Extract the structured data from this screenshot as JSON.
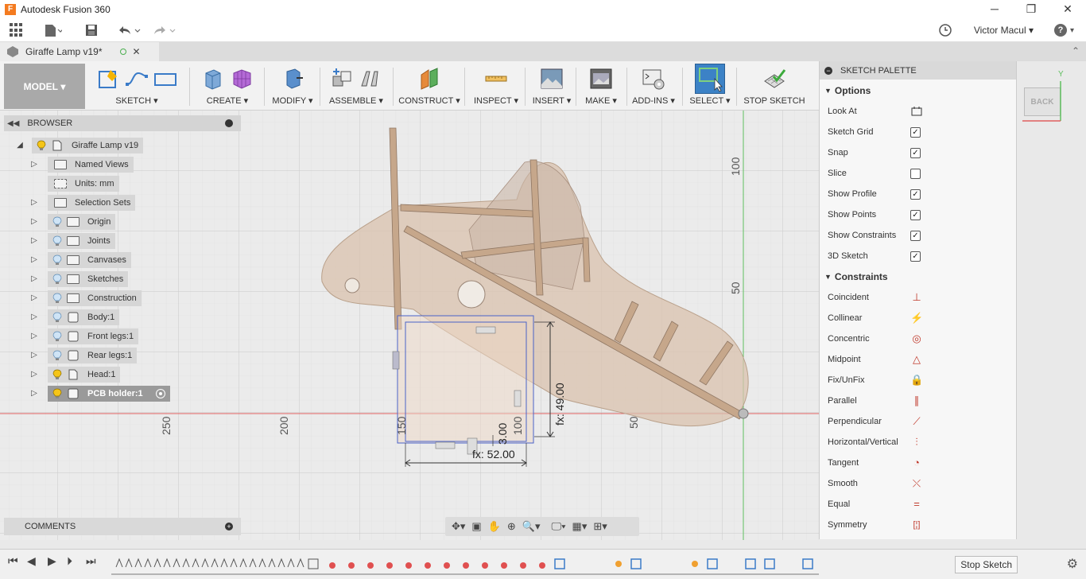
{
  "window": {
    "title": "Autodesk Fusion 360",
    "controls": {
      "minimize": "─",
      "maximize": "❐",
      "close": "✕"
    }
  },
  "qat": {
    "user": "Victor Macul",
    "help": "?"
  },
  "doc_tab": {
    "title": "Giraffe Lamp v19*"
  },
  "toolbar": {
    "workspace": "MODEL",
    "groups": [
      {
        "label": "SKETCH ▾"
      },
      {
        "label": "CREATE ▾"
      },
      {
        "label": "MODIFY ▾"
      },
      {
        "label": "ASSEMBLE ▾"
      },
      {
        "label": "CONSTRUCT ▾"
      },
      {
        "label": "INSPECT ▾"
      },
      {
        "label": "INSERT ▾"
      },
      {
        "label": "MAKE ▾"
      },
      {
        "label": "ADD-INS ▾"
      },
      {
        "label": "SELECT ▾"
      },
      {
        "label": "STOP SKETCH"
      }
    ]
  },
  "browser": {
    "title": "BROWSER",
    "items": [
      {
        "label": "Giraffe Lamp v19"
      },
      {
        "label": "Named Views"
      },
      {
        "label": "Units: mm"
      },
      {
        "label": "Selection Sets"
      },
      {
        "label": "Origin"
      },
      {
        "label": "Joints"
      },
      {
        "label": "Canvases"
      },
      {
        "label": "Sketches"
      },
      {
        "label": "Construction"
      },
      {
        "label": "Body:1"
      },
      {
        "label": "Front legs:1"
      },
      {
        "label": "Rear legs:1"
      },
      {
        "label": "Head:1"
      },
      {
        "label": "PCB holder:1"
      }
    ]
  },
  "canvas": {
    "axis_labels": {
      "y100": "100",
      "y50": "50",
      "x250": "250",
      "x200": "200",
      "x150": "150",
      "x100": "100",
      "x50": "50"
    },
    "dims": {
      "height": "fx: 49.00",
      "width": "fx: 52.00",
      "small": "3.00"
    }
  },
  "viewcube": {
    "face": "BACK",
    "axis": "Y"
  },
  "palette": {
    "title": "SKETCH PALETTE",
    "options_title": "Options",
    "options": [
      {
        "label": "Look At",
        "icon": "look-at-icon",
        "checked": null
      },
      {
        "label": "Sketch Grid",
        "checked": true
      },
      {
        "label": "Snap",
        "checked": true
      },
      {
        "label": "Slice",
        "checked": false
      },
      {
        "label": "Show Profile",
        "checked": true
      },
      {
        "label": "Show Points",
        "checked": true
      },
      {
        "label": "Show Constraints",
        "checked": true
      },
      {
        "label": "3D Sketch",
        "checked": true
      }
    ],
    "constraints_title": "Constraints",
    "constraints": [
      {
        "label": "Coincident",
        "glyph": "⊥"
      },
      {
        "label": "Collinear",
        "glyph": "⚡"
      },
      {
        "label": "Concentric",
        "glyph": "◎"
      },
      {
        "label": "Midpoint",
        "glyph": "△"
      },
      {
        "label": "Fix/UnFix",
        "glyph": "🔒"
      },
      {
        "label": "Parallel",
        "glyph": "∥"
      },
      {
        "label": "Perpendicular",
        "glyph": "⟋"
      },
      {
        "label": "Horizontal/Vertical",
        "glyph": "⫶"
      },
      {
        "label": "Tangent",
        "glyph": "◔"
      },
      {
        "label": "Smooth",
        "glyph": "⤬"
      },
      {
        "label": "Equal",
        "glyph": "="
      },
      {
        "label": "Symmetry",
        "glyph": "[¦]"
      }
    ],
    "stop_sketch": "Stop Sketch"
  },
  "comments": {
    "title": "COMMENTS"
  }
}
